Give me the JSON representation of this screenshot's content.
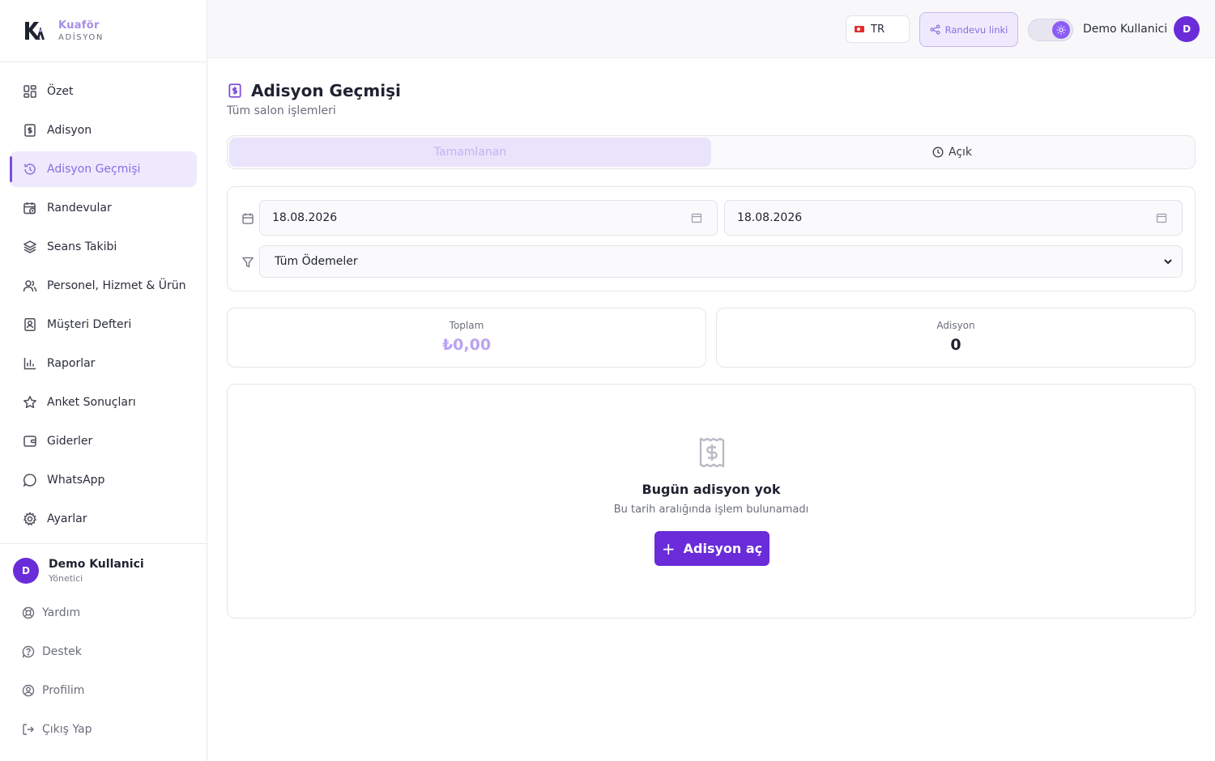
{
  "brand": {
    "name": "Kuaför",
    "sub": "ADİSYON",
    "accent": "#a58ee6"
  },
  "sidebar": {
    "items": [
      {
        "label": "Özet",
        "icon": "dashboard-grid-icon"
      },
      {
        "label": "Adisyon",
        "icon": "receipt-icon"
      },
      {
        "label": "Adisyon Geçmişi",
        "icon": "history-icon",
        "active": true
      },
      {
        "label": "Randevular",
        "icon": "calendar-clock-icon"
      },
      {
        "label": "Seans Takibi",
        "icon": "layers-icon"
      },
      {
        "label": "Personel, Hizmet & Ürün",
        "icon": "users-icon"
      },
      {
        "label": "Müşteri Defteri",
        "icon": "contact-book-icon"
      },
      {
        "label": "Raporlar",
        "icon": "bar-chart-icon"
      },
      {
        "label": "Anket Sonuçları",
        "icon": "star-icon"
      },
      {
        "label": "Giderler",
        "icon": "wallet-icon"
      },
      {
        "label": "WhatsApp",
        "icon": "chat-bubble-icon"
      },
      {
        "label": "Ayarlar",
        "icon": "gear-icon"
      }
    ],
    "user": {
      "initial": "D",
      "name": "Demo Kullanici",
      "role": "Yönetici"
    },
    "footer": [
      {
        "label": "Yardım",
        "icon": "lifebuoy-icon"
      },
      {
        "label": "Destek",
        "icon": "help-circle-icon"
      },
      {
        "label": "Profilim",
        "icon": "user-circle-icon"
      },
      {
        "label": "Çıkış Yap",
        "icon": "logout-icon"
      }
    ]
  },
  "topbar": {
    "language": "TR",
    "randevu_link": "Randevu linki",
    "user_name": "Demo Kullanici",
    "user_initial": "D"
  },
  "page": {
    "title": "Adisyon Geçmişi",
    "subtitle": "Tüm salon işlemleri",
    "tabs": [
      {
        "label": "Tamamlanan",
        "active": true
      },
      {
        "label": "Açık",
        "active": false
      }
    ],
    "filters": {
      "date_from": "18.08.2026",
      "date_to": "18.08.2026",
      "payment_filter": "Tüm Ödemeler"
    },
    "stats": {
      "total_label": "Toplam",
      "total_value": "₺0,00",
      "count_label": "Adisyon",
      "count_value": "0"
    },
    "empty": {
      "title": "Bugün adisyon yok",
      "subtitle": "Bu tarih aralığında işlem bulunamadı",
      "button": "Adisyon aç"
    }
  },
  "colors": {
    "primary": "#6a2bd9",
    "active_bg": "#eee9fd",
    "active_text": "#8a6ee0",
    "total_value": "#b9a3f0"
  }
}
